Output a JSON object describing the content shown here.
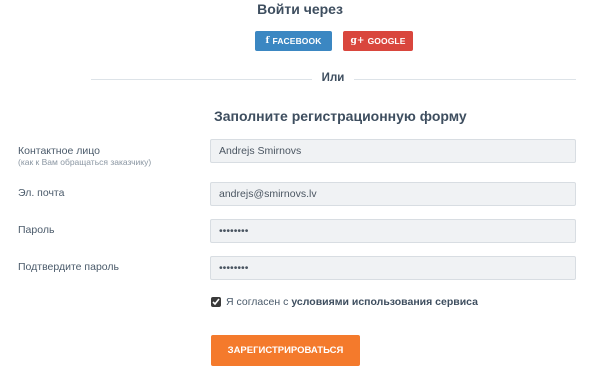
{
  "social": {
    "title": "Войти через",
    "facebook_icon": "f",
    "facebook_label": "FACEBOOK",
    "google_icon": "g+",
    "google_label": "GOOGLE"
  },
  "divider": {
    "text": "Или"
  },
  "form": {
    "title": "Заполните регистрационную форму",
    "contact": {
      "label": "Контактное лицо",
      "hint": "(как к Вам обращаться заказчику)",
      "value": "Andrejs Smirnovs"
    },
    "email": {
      "label": "Эл. почта",
      "value": "andrejs@smirnovs.lv"
    },
    "password": {
      "label": "Пароль",
      "value": "••••••••"
    },
    "confirm_password": {
      "label": "Подтвердите пароль",
      "value": "••••••••"
    },
    "agree": {
      "text": "Я согласен с",
      "link": "условиями использования сервиса"
    },
    "submit_label": "ЗАРЕГИСТРИРОВАТЬСЯ"
  },
  "colors": {
    "facebook": "#3b87c2",
    "google": "#d9463d",
    "submit": "#f47a2c",
    "heading": "#3e4e5f"
  }
}
